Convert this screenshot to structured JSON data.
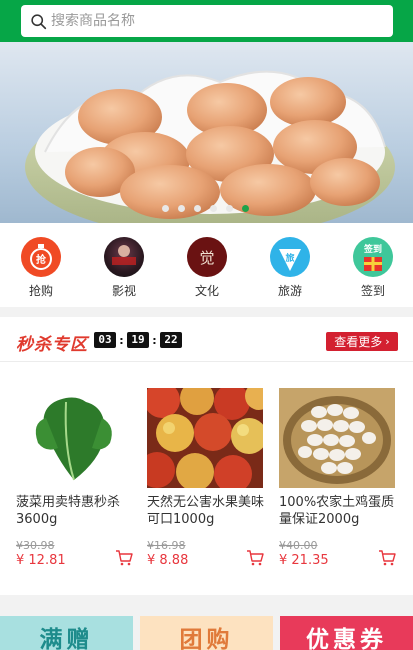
{
  "search": {
    "placeholder": "搜索商品名称"
  },
  "banner": {
    "slide_count": 6,
    "active_slide": 5
  },
  "categories": [
    {
      "label": "抢购",
      "icon": "rush-buy-icon",
      "badge": "抢"
    },
    {
      "label": "影视",
      "icon": "movie-icon",
      "badge": ""
    },
    {
      "label": "文化",
      "icon": "culture-icon",
      "badge": "觉"
    },
    {
      "label": "旅游",
      "icon": "travel-icon",
      "badge": "旅"
    },
    {
      "label": "签到",
      "icon": "checkin-icon",
      "badge": "签到"
    }
  ],
  "flash_sale": {
    "title": "秒杀专区",
    "timer": {
      "h": "03",
      "m": "19",
      "s": "22"
    },
    "more_label": "查看更多",
    "products": [
      {
        "name": "菠菜用卖特惠秒杀3600g",
        "old_price": "¥30.98",
        "price": "¥ 12.81"
      },
      {
        "name": "天然无公害水果美味可口1000g",
        "old_price": "¥16.98",
        "price": "¥ 8.88"
      },
      {
        "name": "100%农家土鸡蛋质量保证2000g",
        "old_price": "¥40.00",
        "price": "¥ 21.35"
      }
    ]
  },
  "promos": [
    {
      "label": "满赠",
      "color": "#1e8c8c",
      "bg": "#a8e0e0"
    },
    {
      "label": "团购",
      "color": "#e07a3a",
      "bg": "#fde2c0"
    },
    {
      "label": "优惠券",
      "color": "#ffffff",
      "bg": "#e83a5a"
    }
  ],
  "colors": {
    "brand": "#06a647",
    "accent": "#d32030",
    "price": "#e8373e"
  }
}
